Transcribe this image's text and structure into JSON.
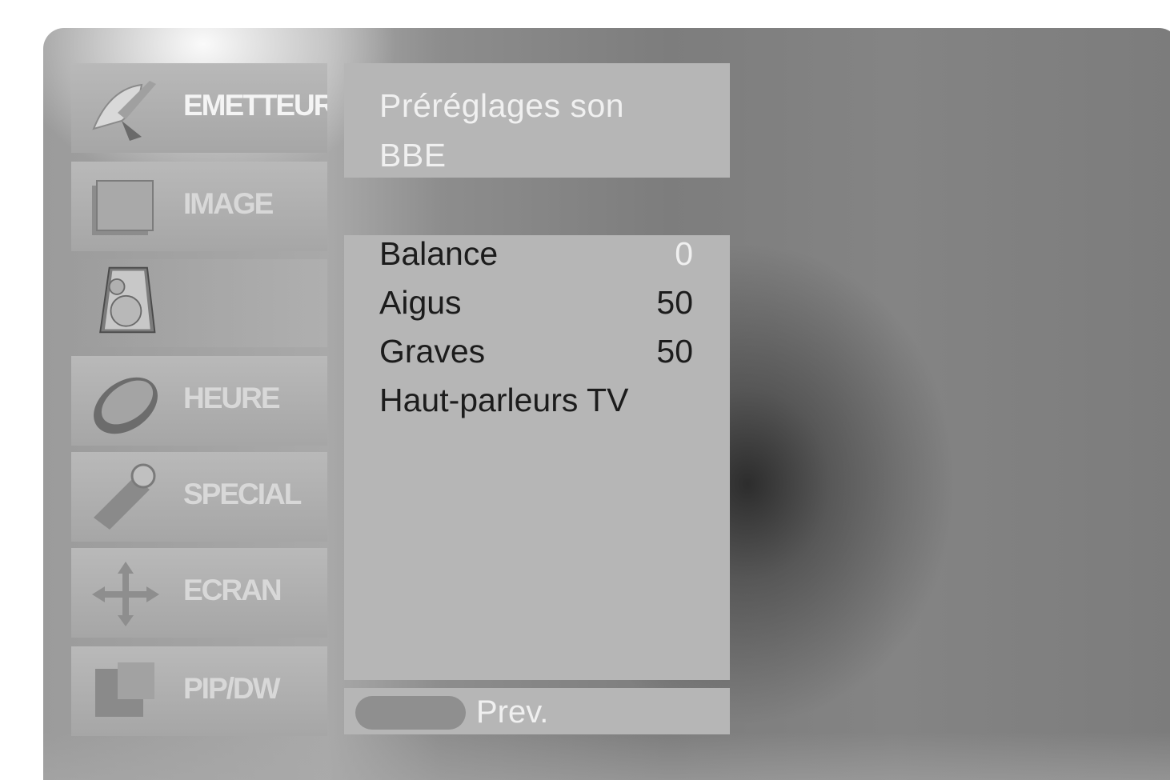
{
  "menu": {
    "items": [
      {
        "label": "EMETTEUR",
        "icon": "satellite-dish-icon"
      },
      {
        "label": "IMAGE",
        "icon": "picture-frame-icon"
      },
      {
        "label": "",
        "icon": "speaker-icon"
      },
      {
        "label": "HEURE",
        "icon": "clock-icon"
      },
      {
        "label": "SPECIAL",
        "icon": "key-tag-icon"
      },
      {
        "label": "ECRAN",
        "icon": "move-arrows-icon"
      },
      {
        "label": "PIP/DW",
        "icon": "pip-screen-icon"
      }
    ],
    "selected_index": 2
  },
  "presets": {
    "line1": "Préréglages son",
    "line2": "BBE"
  },
  "settings": [
    {
      "label": "Balance",
      "value": "0"
    },
    {
      "label": "Aigus",
      "value": "50"
    },
    {
      "label": "Graves",
      "value": "50"
    },
    {
      "label": "Haut-parleurs TV",
      "value": ""
    }
  ],
  "footer": {
    "prev_label": "Prev."
  }
}
